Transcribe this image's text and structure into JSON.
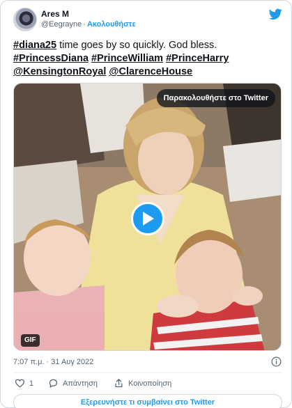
{
  "author": {
    "display_name": "Ares M",
    "handle": "@Eegrayne",
    "follow_label": "Ακολουθήστε"
  },
  "tweet": {
    "lines": [
      [
        {
          "text": "#diana25",
          "tag": true
        },
        {
          "text": " time goes by so quickly.  God bless.",
          "tag": false
        }
      ],
      [
        {
          "text": "#PrincessDiana",
          "tag": true
        },
        {
          "text": " ",
          "tag": false
        },
        {
          "text": "#PrinceWilliam",
          "tag": true
        },
        {
          "text": " ",
          "tag": false
        },
        {
          "text": "#PrinceHarry",
          "tag": true
        }
      ],
      [
        {
          "text": "@KensingtonRoyal",
          "tag": true
        },
        {
          "text": " ",
          "tag": false
        },
        {
          "text": "@ClarenceHouse",
          "tag": true
        }
      ]
    ]
  },
  "media": {
    "watch_label": "Παρακολουθήστε στο Twitter",
    "badge": "GIF"
  },
  "timestamp": "7:07 π.μ. · 31 Αυγ 2022",
  "actions": {
    "like_count": "1",
    "reply_label": "Απάντηση",
    "share_label": "Κοινοποίηση"
  },
  "explore_label": "Εξερευνήστε τι συμβαίνει στο Twitter",
  "colors": {
    "accent": "#1d9bf0",
    "text": "#0f1419",
    "secondary": "#536471"
  }
}
